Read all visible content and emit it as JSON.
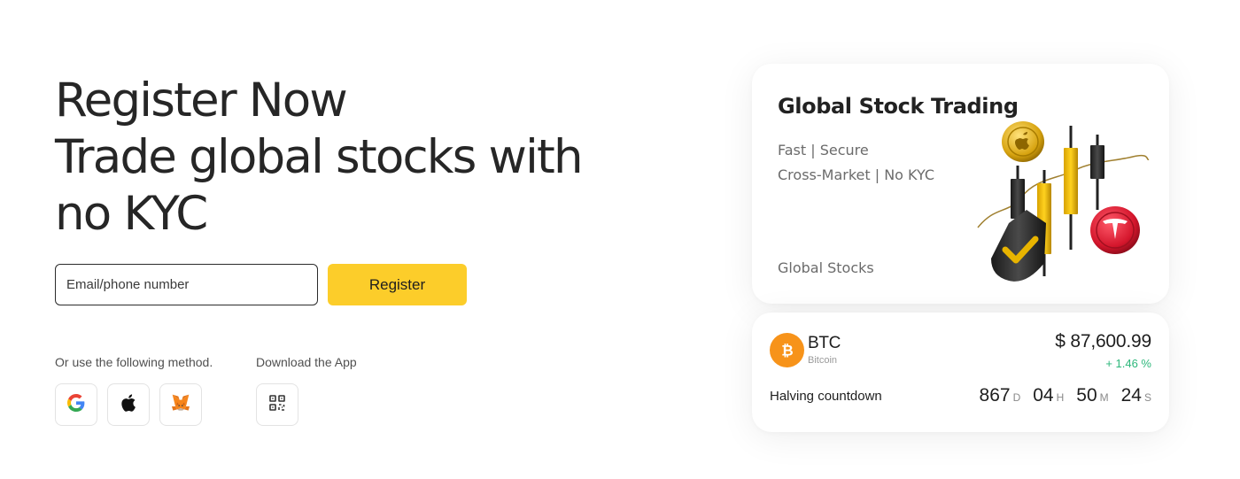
{
  "hero": {
    "line1": "Register Now",
    "line2": "Trade global stocks with",
    "line3": "no KYC"
  },
  "signup": {
    "email_placeholder": "Email/phone number",
    "register_label": "Register"
  },
  "methods": {
    "label": "Or use the following method.",
    "options": [
      "google-icon",
      "apple-icon",
      "metamask-icon"
    ]
  },
  "app": {
    "label": "Download the App",
    "icon": "qr-code-icon"
  },
  "promo_card": {
    "title": "Global Stock Trading",
    "line1": "Fast | Secure",
    "line2": "Cross-Market | No KYC",
    "footer": "Global Stocks"
  },
  "btc_card": {
    "symbol": "BTC",
    "name": "Bitcoin",
    "price": "$ 87,600.99",
    "change": "+ 1.46 %",
    "halving_label": "Halving countdown",
    "countdown": {
      "days": "867",
      "days_unit": "D",
      "hours": "04",
      "hours_unit": "H",
      "minutes": "50",
      "minutes_unit": "M",
      "seconds": "24",
      "seconds_unit": "S"
    }
  },
  "colors": {
    "accent": "#fccd2a",
    "bitcoin": "#f7931a",
    "positive": "#2db77b"
  }
}
